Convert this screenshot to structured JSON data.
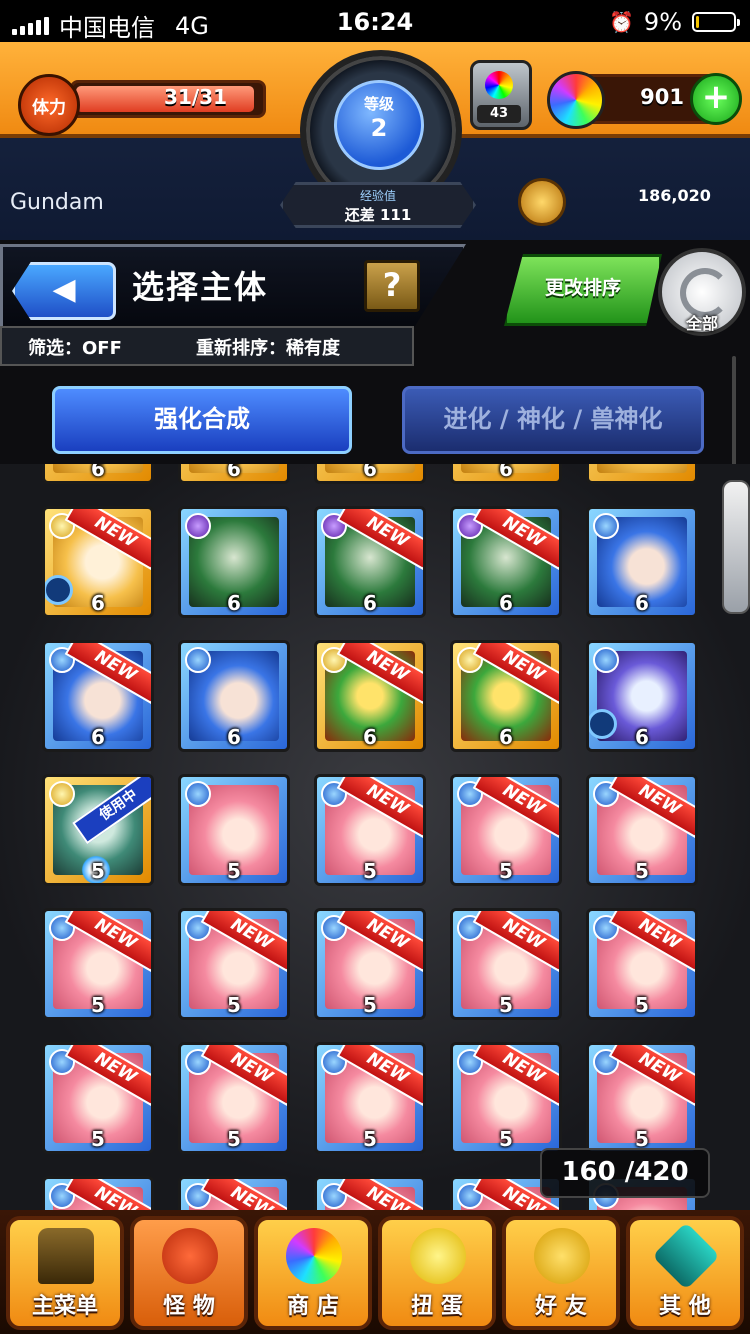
{
  "status_bar": {
    "carrier": "中国电信",
    "network": "4G",
    "time": "16:24",
    "battery": "9%",
    "battery_level": 0.09
  },
  "header": {
    "stamina_label": "体力",
    "stamina_value": "31/31",
    "stamina_fraction": 1.0,
    "level_label": "等级",
    "level_value": "2",
    "exp_label": "经验值",
    "exp_remaining": "还差 111",
    "box_count": "43",
    "orb_count": "901",
    "player_name": "Gundam",
    "coin_count": "186,020"
  },
  "select": {
    "title": "选择主体",
    "help_label": "?",
    "filter_label": "筛选：OFF",
    "sort_label": "重新排序：稀有度",
    "sort_change_label": "更改排序",
    "refresh_label": "全部"
  },
  "tabs": [
    {
      "label": "强化合成",
      "active": true
    },
    {
      "label": "进化 / 神化 / 兽神化",
      "active": false
    }
  ],
  "monster_grid": {
    "top_partial_row": [
      "6",
      "6",
      "6",
      "6",
      ""
    ],
    "rows": [
      [
        {
          "rarity": "6",
          "element": "light",
          "art": "blonde",
          "new": true
        },
        {
          "rarity": "6",
          "element": "dark",
          "art": "skull",
          "new": false
        },
        {
          "rarity": "6",
          "element": "dark",
          "art": "skull",
          "new": true
        },
        {
          "rarity": "6",
          "element": "dark",
          "art": "skull",
          "new": true
        },
        {
          "rarity": "6",
          "element": "water",
          "art": "blue-hair",
          "new": false
        }
      ],
      [
        {
          "rarity": "6",
          "element": "water",
          "art": "blue-hair",
          "new": true
        },
        {
          "rarity": "6",
          "element": "water",
          "art": "blue-hair",
          "new": false
        },
        {
          "rarity": "6",
          "element": "light",
          "art": "goblin",
          "new": true
        },
        {
          "rarity": "6",
          "element": "light",
          "art": "goblin",
          "new": true
        },
        {
          "rarity": "6",
          "element": "water",
          "art": "flower",
          "new": false
        }
      ],
      [
        {
          "rarity": "5",
          "element": "light",
          "art": "mask",
          "new": false,
          "in_use": true
        },
        {
          "rarity": "5",
          "element": "water",
          "art": "pink-hair",
          "new": false
        },
        {
          "rarity": "5",
          "element": "water",
          "art": "pink-hair",
          "new": true
        },
        {
          "rarity": "5",
          "element": "water",
          "art": "pink-hair",
          "new": true
        },
        {
          "rarity": "5",
          "element": "water",
          "art": "pink-hair",
          "new": true
        }
      ],
      [
        {
          "rarity": "5",
          "element": "water",
          "art": "pink-hair",
          "new": true
        },
        {
          "rarity": "5",
          "element": "water",
          "art": "pink-hair",
          "new": true
        },
        {
          "rarity": "5",
          "element": "water",
          "art": "pink-hair",
          "new": true
        },
        {
          "rarity": "5",
          "element": "water",
          "art": "pink-hair",
          "new": true
        },
        {
          "rarity": "5",
          "element": "water",
          "art": "pink-hair",
          "new": true
        }
      ],
      [
        {
          "rarity": "5",
          "element": "water",
          "art": "pink-hair",
          "new": true
        },
        {
          "rarity": "5",
          "element": "water",
          "art": "pink-hair",
          "new": true
        },
        {
          "rarity": "5",
          "element": "water",
          "art": "pink-hair",
          "new": true
        },
        {
          "rarity": "5",
          "element": "water",
          "art": "pink-hair",
          "new": true
        },
        {
          "rarity": "5",
          "element": "water",
          "art": "pink-hair",
          "new": true
        }
      ],
      [
        {
          "rarity": "",
          "element": "water",
          "art": "pink-hair",
          "new": true
        },
        {
          "rarity": "",
          "element": "water",
          "art": "pink-hair",
          "new": true
        },
        {
          "rarity": "",
          "element": "water",
          "art": "pink-hair",
          "new": true
        },
        {
          "rarity": "",
          "element": "water",
          "art": "pink-hair",
          "new": true
        },
        {
          "rarity": "",
          "element": "water",
          "art": "pink-hair",
          "new": false
        }
      ]
    ],
    "new_badge": "NEW",
    "in_use_badge": "使用中",
    "count": "160 /420"
  },
  "bottom_nav": [
    {
      "label": "主菜单",
      "icon": "gate-icon"
    },
    {
      "label": "怪 物",
      "icon": "monster-icon",
      "active": true
    },
    {
      "label": "商 店",
      "icon": "orb-icon"
    },
    {
      "label": "扭 蛋",
      "icon": "egg-icon"
    },
    {
      "label": "好 友",
      "icon": "balloons-icon"
    },
    {
      "label": "其 他",
      "icon": "question-diamond-icon"
    }
  ]
}
